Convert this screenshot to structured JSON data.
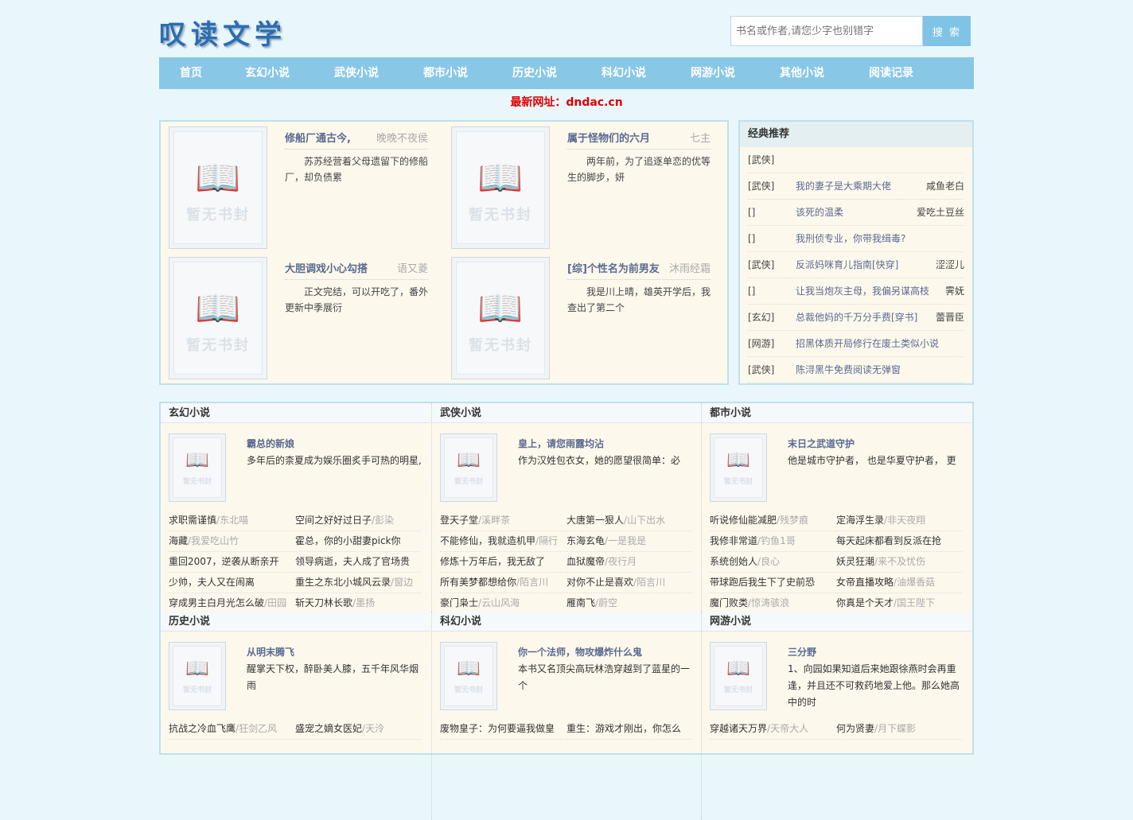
{
  "site": {
    "logo": "叹读文学",
    "search_placeholder": "书名或作者,请您少字也别错字",
    "search_button": "搜 索",
    "notice": "最新网址：dndac.cn"
  },
  "nav": [
    "首页",
    "玄幻小说",
    "武侠小说",
    "都市小说",
    "历史小说",
    "科幻小说",
    "网游小说",
    "其他小说",
    "阅读记录"
  ],
  "cover_text": "暂无书封",
  "hot": [
    {
      "title": "修船厂通古今,",
      "author": "晚晚不夜侯",
      "desc": "苏苏经营着父母遗留下的修船厂，却负债累"
    },
    {
      "title": "属于怪物们的六月",
      "author": "七主",
      "desc": "两年前，为了追逐单恋的优等生的脚步，妍"
    },
    {
      "title": "大胆调戏小心勾搭",
      "author": "语又菱",
      "desc": "正文完结，可以开吃了，番外更新中季展衍"
    },
    {
      "title": "[综]个性名为前男友",
      "author": "沐雨经霜",
      "desc": "我是川上晴，雄英开学后，我查出了第二个"
    }
  ],
  "recommend": {
    "title": "经典推荐",
    "rows": [
      {
        "cat": "[武侠]",
        "title": "",
        "author": ""
      },
      {
        "cat": "[武侠]",
        "title": "我的妻子是大乘期大佬",
        "author": "咸鱼老白"
      },
      {
        "cat": "[]",
        "title": "该死的温柔",
        "author": "爱吃土豆丝"
      },
      {
        "cat": "[]",
        "title": "我刑侦专业，你带我缉毒?",
        "author": ""
      },
      {
        "cat": "[武侠]",
        "title": "反派妈咪育儿指南[快穿]",
        "author": "涩涩儿"
      },
      {
        "cat": "[]",
        "title": "让我当炮灰主母，我偏另谋高枝",
        "author": "霁妩"
      },
      {
        "cat": "[玄幻]",
        "title": "总裁他妈的千万分手费[穿书]",
        "author": "蕾晋臣"
      },
      {
        "cat": "[网游]",
        "title": "招黑体质开局修行在废土类似小说",
        "author": ""
      },
      {
        "cat": "[武侠]",
        "title": "陈浔黑牛免费阅读无弹窗",
        "author": ""
      }
    ]
  },
  "categories": [
    {
      "name": "玄幻小说",
      "top_title": "霸总的新娘",
      "top_desc": "多年后的柰夏成为娱乐圈炙手可热的明星,",
      "items": [
        {
          "t": "求职需谨慎",
          "a": "东北喵"
        },
        {
          "t": "空间之好好过日子",
          "a": "彭染"
        },
        {
          "t": "海藏",
          "a": "我爱吃山竹"
        },
        {
          "t": "霍总，你的小甜妻pick你",
          "a": ""
        },
        {
          "t": "重回2007，逆袭从断亲开",
          "a": ""
        },
        {
          "t": "领导病逝，夫人成了官场贵",
          "a": ""
        },
        {
          "t": "少帅，夫人又在闹离",
          "a": ""
        },
        {
          "t": "重生之东北小城风云录",
          "a": "窗边"
        },
        {
          "t": "穿成男主白月光怎么破",
          "a": "田园"
        },
        {
          "t": "斩天刀林长歌",
          "a": "墨扬"
        }
      ]
    },
    {
      "name": "武侠小说",
      "top_title": "皇上，请您雨露均沾",
      "top_desc": "作为汉姓包衣女，她的愿望很简单：必",
      "items": [
        {
          "t": "登天子堂",
          "a": "溪畔茶"
        },
        {
          "t": "大唐第一狠人",
          "a": "山下出水"
        },
        {
          "t": "不能修仙，我就造机甲",
          "a": "隔行"
        },
        {
          "t": "东海玄龟",
          "a": "一是我是"
        },
        {
          "t": "修炼十万年后，我无敌了",
          "a": ""
        },
        {
          "t": "血狱魔帝",
          "a": "夜行月"
        },
        {
          "t": "所有美梦都想给你",
          "a": "陌言川"
        },
        {
          "t": "对你不止是喜欢",
          "a": "陌言川"
        },
        {
          "t": "豪门枭士",
          "a": "云山风海"
        },
        {
          "t": "雁南飞",
          "a": "蔚空"
        }
      ]
    },
    {
      "name": "都市小说",
      "top_title": "末日之武道守护",
      "top_desc": "他是城市守护者， 也是华夏守护者， 更",
      "items": [
        {
          "t": "听说修仙能减肥",
          "a": "残梦痕"
        },
        {
          "t": "定海浮生录",
          "a": "非天夜翔"
        },
        {
          "t": "我修非常道",
          "a": "钓鱼1哥"
        },
        {
          "t": "每天起床都看到反派在抢",
          "a": ""
        },
        {
          "t": "系统创始人",
          "a": "良心"
        },
        {
          "t": "妖灵狂潮",
          "a": "来不及忧伤"
        },
        {
          "t": "带球跑后我生下了史前恐",
          "a": ""
        },
        {
          "t": "女帝直播攻略",
          "a": "油爆香菇"
        },
        {
          "t": "魔门败类",
          "a": "惊涛骇浪"
        },
        {
          "t": "你真是个天才",
          "a": "国王陛下"
        }
      ]
    },
    {
      "name": "历史小说",
      "top_title": "从明末腾飞",
      "top_desc": "醒掌天下权，醉卧美人膝，五千年风华烟雨",
      "items": [
        {
          "t": "抗战之冷血飞鹰",
          "a": "狂剑乙风"
        },
        {
          "t": "盛宠之嫡女医妃",
          "a": "天泠"
        }
      ]
    },
    {
      "name": "科幻小说",
      "top_title": "你一个法师，物攻爆炸什么鬼",
      "top_desc": "本书又名顶尖高玩林浩穿越到了蓝星的一个",
      "items": [
        {
          "t": "废物皇子：为何要逼我做皇",
          "a": ""
        },
        {
          "t": "重生：游戏才刚出，你怎么",
          "a": ""
        }
      ]
    },
    {
      "name": "网游小说",
      "top_title": "三分野",
      "top_desc": "1、向园如果知道后来她跟徐燕时会再重逢，并且还不可救药地爱上他。那么她高中的时",
      "items": [
        {
          "t": "穿越诸天万界",
          "a": "天帝大人"
        },
        {
          "t": "何为贤妻",
          "a": "月下蝶影"
        }
      ]
    }
  ]
}
